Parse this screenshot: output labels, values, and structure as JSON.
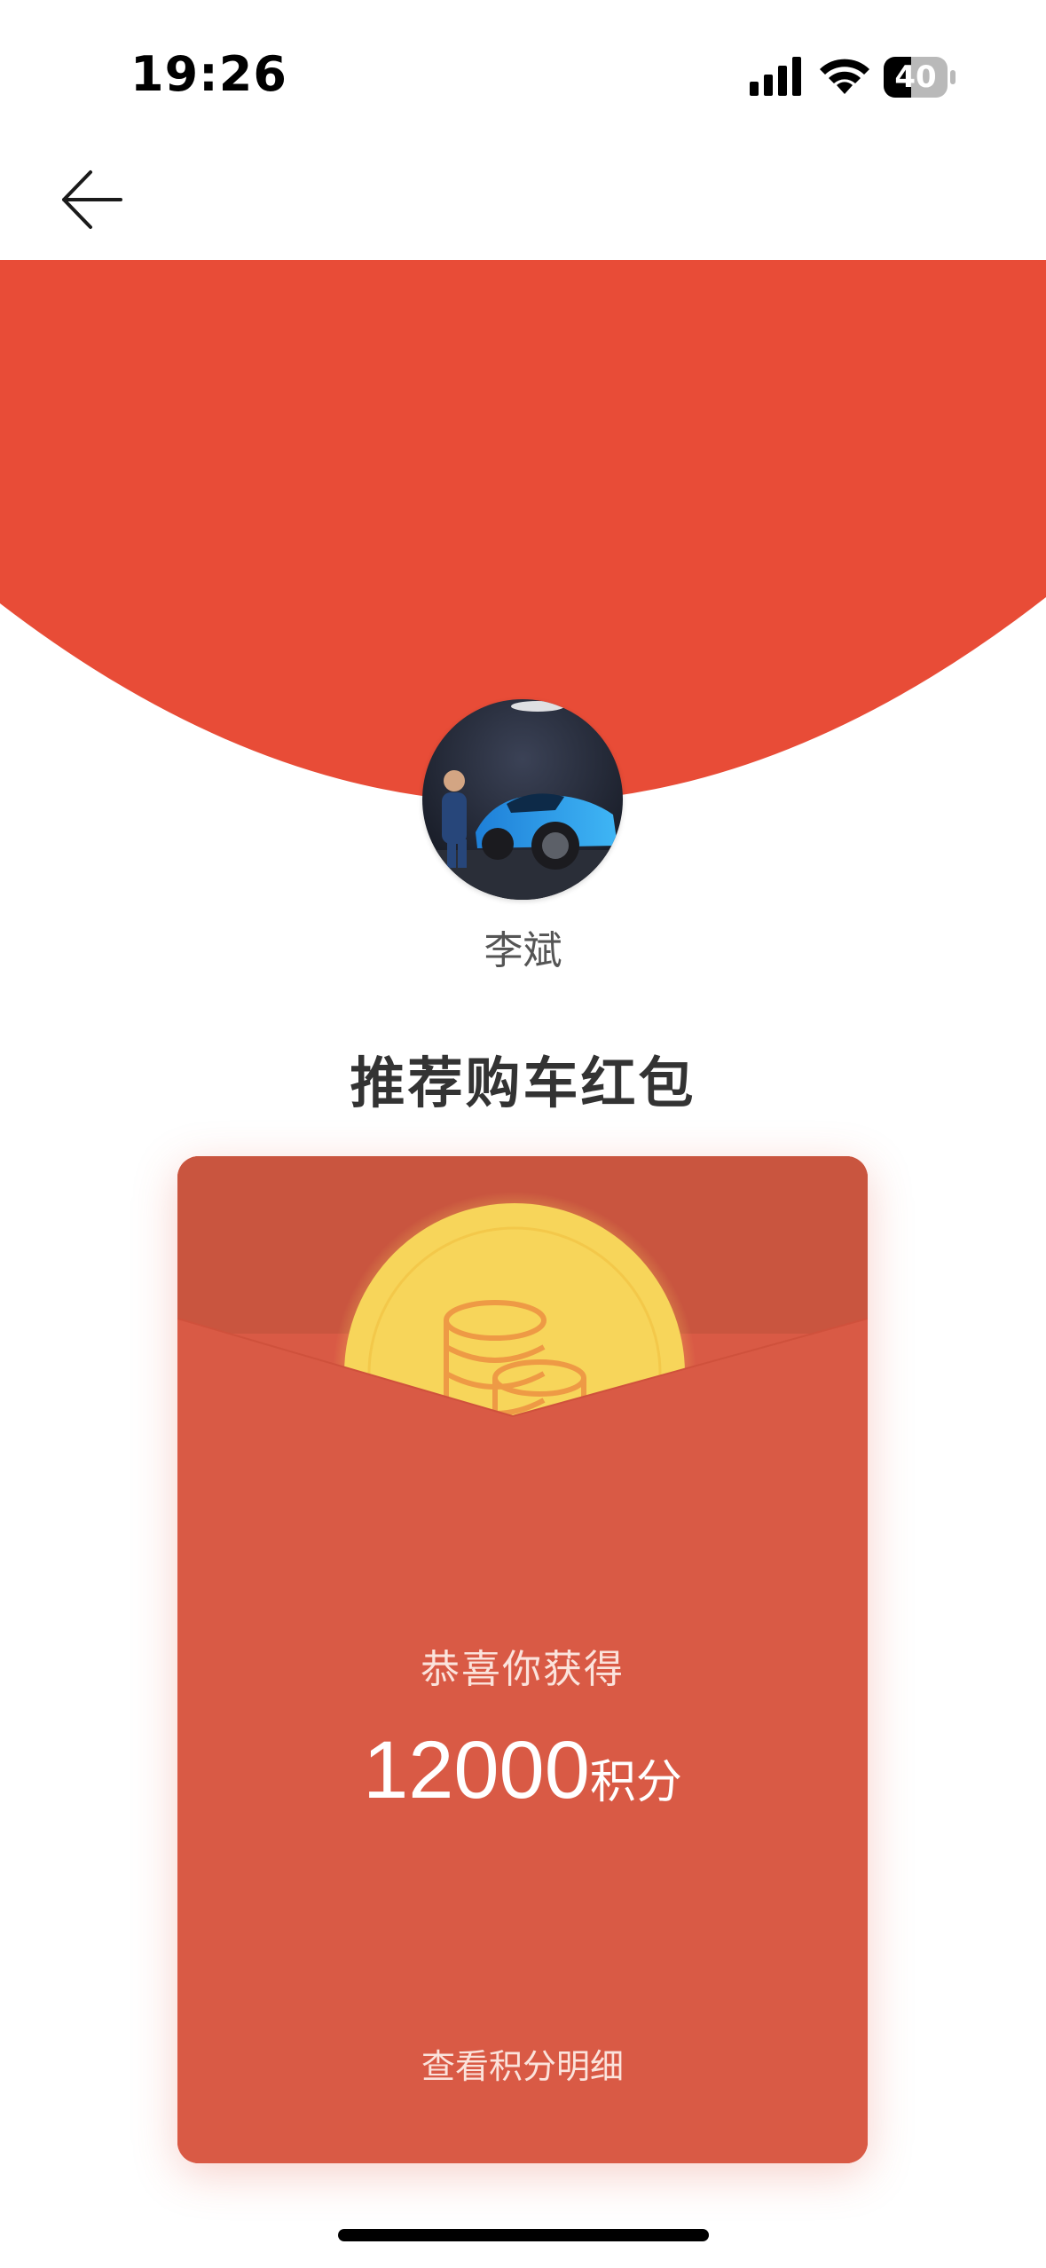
{
  "status_bar": {
    "time": "19:26",
    "battery_level": "40",
    "icons": [
      "signal-icon",
      "wifi-icon",
      "battery-icon"
    ]
  },
  "nav": {
    "back_icon": "arrow-left-icon"
  },
  "profile": {
    "name": "李斌"
  },
  "page": {
    "title": "推荐购车红包"
  },
  "envelope": {
    "coin_icon": "coins-icon",
    "congrats": "恭喜你获得",
    "points_value": "12000",
    "points_unit": "积分",
    "details_link": "查看积分明细"
  },
  "colors": {
    "header_red": "#E84C37",
    "envelope_top": "#C9553F",
    "envelope_body": "#D95A45",
    "coin_yellow": "#F7D55A",
    "coin_icon_orange": "#EE9A45"
  }
}
